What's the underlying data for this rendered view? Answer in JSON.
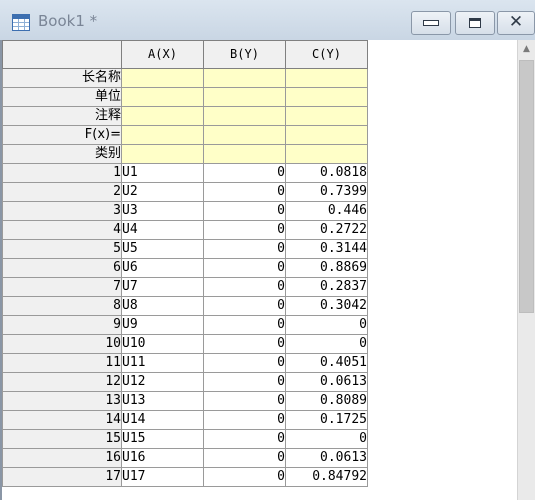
{
  "window": {
    "title": "Book1 *",
    "minimize_icon": "minimize-icon",
    "maximize_icon": "maximize-icon",
    "close_icon": "close-icon",
    "close_glyph": "✕"
  },
  "sheet": {
    "columns": [
      "A(X)",
      "B(Y)",
      "C(Y)"
    ],
    "meta_rows": [
      "长名称",
      "单位",
      "注释",
      "F(x)=",
      "类别"
    ],
    "rows": [
      {
        "n": "1",
        "a": "U1",
        "b": "0",
        "c": "0.0818"
      },
      {
        "n": "2",
        "a": "U2",
        "b": "0",
        "c": "0.7399"
      },
      {
        "n": "3",
        "a": "U3",
        "b": "0",
        "c": "0.446"
      },
      {
        "n": "4",
        "a": "U4",
        "b": "0",
        "c": "0.2722"
      },
      {
        "n": "5",
        "a": "U5",
        "b": "0",
        "c": "0.3144"
      },
      {
        "n": "6",
        "a": "U6",
        "b": "0",
        "c": "0.8869"
      },
      {
        "n": "7",
        "a": "U7",
        "b": "0",
        "c": "0.2837"
      },
      {
        "n": "8",
        "a": "U8",
        "b": "0",
        "c": "0.3042"
      },
      {
        "n": "9",
        "a": "U9",
        "b": "0",
        "c": "0"
      },
      {
        "n": "10",
        "a": "U10",
        "b": "0",
        "c": "0"
      },
      {
        "n": "11",
        "a": "U11",
        "b": "0",
        "c": "0.4051"
      },
      {
        "n": "12",
        "a": "U12",
        "b": "0",
        "c": "0.0613"
      },
      {
        "n": "13",
        "a": "U13",
        "b": "0",
        "c": "0.8089"
      },
      {
        "n": "14",
        "a": "U14",
        "b": "0",
        "c": "0.1725"
      },
      {
        "n": "15",
        "a": "U15",
        "b": "0",
        "c": "0"
      },
      {
        "n": "16",
        "a": "U16",
        "b": "0",
        "c": "0.0613"
      },
      {
        "n": "17",
        "a": "U17",
        "b": "0",
        "c": "0.84792"
      }
    ]
  },
  "scrollbar": {
    "up_arrow_icon": "chevron-up-icon",
    "up_glyph": "▲"
  },
  "colors": {
    "meta_fill": "#ffffc8",
    "header_fill": "#f0f0f0",
    "titlebar": "#d2dde9"
  }
}
